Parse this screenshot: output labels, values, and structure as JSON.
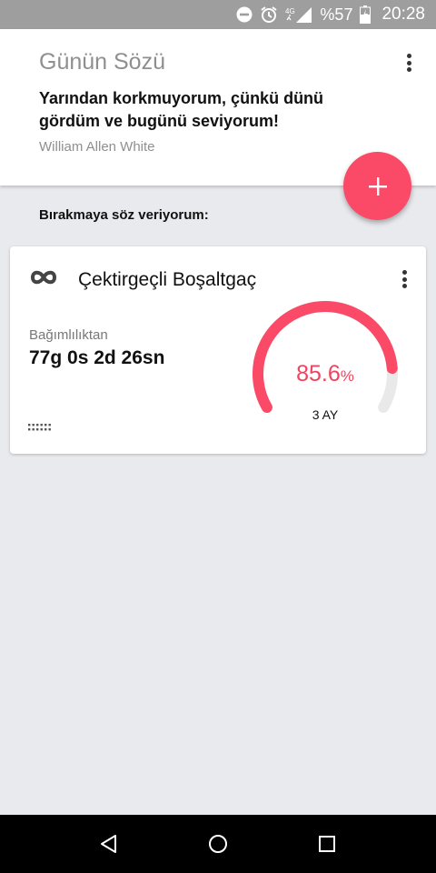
{
  "status_bar": {
    "network": "4G",
    "battery": "%57",
    "time": "20:28",
    "icons": [
      "do-not-disturb-icon",
      "alarm-icon",
      "signal-icon",
      "battery-charging-icon"
    ]
  },
  "quote": {
    "title": "Günün Sözü",
    "text": "Yarından korkmuyorum, çünkü dünü gördüm ve bugünü seviyorum!",
    "author": "William Allen White"
  },
  "fab_icon": "plus-icon",
  "section_label": "Bırakmaya söz veriyorum:",
  "addiction": {
    "icon": "infinity-icon",
    "title": "Çektirgeçli Boşaltgaç",
    "since_label": "Bağımlılıktan",
    "since_value": "77g 0s 2d 26sn",
    "progress_value": "85.6",
    "progress_unit": "%",
    "progress_fraction": 0.856,
    "goal_label": "3 AY"
  },
  "colors": {
    "accent": "#fa4a67",
    "gauge_track": "#e9e9e9",
    "status_bar": "#9e9e9e",
    "background": "#e9eaee"
  },
  "nav": [
    "back-icon",
    "home-icon",
    "recents-icon"
  ]
}
